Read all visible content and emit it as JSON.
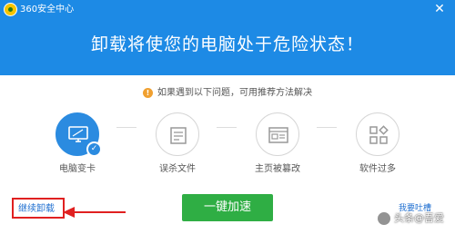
{
  "app": {
    "title": "360安全中心",
    "close_symbol": "✕"
  },
  "header": {
    "headline": "卸载将使您的电脑处于危险状态！"
  },
  "hint": {
    "icon_glyph": "!",
    "text": "如果遇到以下问题，可用推荐方法解决"
  },
  "options": [
    {
      "label": "电脑变卡",
      "icon": "monitor-icon",
      "active": true
    },
    {
      "label": "误杀文件",
      "icon": "file-icon",
      "active": false
    },
    {
      "label": "主页被篡改",
      "icon": "browser-icon",
      "active": false
    },
    {
      "label": "软件过多",
      "icon": "apps-grid-icon",
      "active": false
    }
  ],
  "footer": {
    "continue_label": "继续卸载",
    "speedup_label": "一键加速",
    "feedback_label": "我要吐槽"
  },
  "watermark": {
    "text": "头条@吾爱"
  },
  "colors": {
    "header_blue": "#1d8ae5",
    "button_green": "#2fae44",
    "annotation_red": "#e02020",
    "link_blue": "#1f6fd0"
  }
}
